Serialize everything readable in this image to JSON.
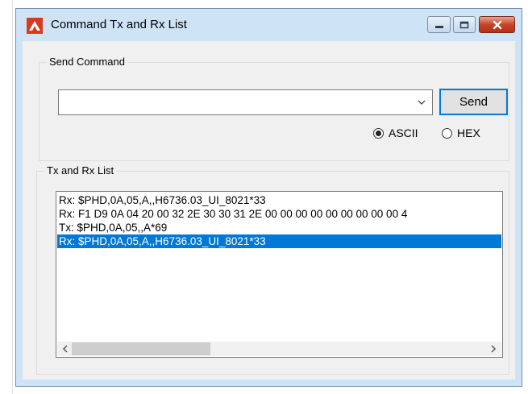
{
  "window": {
    "title": "Command Tx and Rx List",
    "icon": "app-logo-icon",
    "controls": [
      "minimize-icon",
      "maximize-icon",
      "close-icon"
    ]
  },
  "send_group": {
    "label": "Send Command",
    "command_value": "",
    "send_label": "Send",
    "mode_options": [
      {
        "label": "ASCII",
        "checked": true
      },
      {
        "label": "HEX",
        "checked": false
      }
    ]
  },
  "list_group": {
    "label": "Tx and Rx List",
    "items": [
      {
        "text": "Rx: $PHD,0A,05,A,,H6736.03_UI_8021*33",
        "selected": false
      },
      {
        "text": "Rx: F1 D9 0A 04 20 00 32 2E 30 30 31 2E 00 00 00 00 00 00 00 00 00 4",
        "selected": false
      },
      {
        "text": "Tx: $PHD,0A,05,,A*69",
        "selected": false
      },
      {
        "text": "Rx: $PHD,0A,05,A,,H6736.03_UI_8021*33",
        "selected": true
      }
    ],
    "horizontal_scroll_fraction": 0.0
  },
  "colors": {
    "selection": "#0078d7",
    "titlebar": "#cfe3f7",
    "close_button": "#c7452a"
  }
}
